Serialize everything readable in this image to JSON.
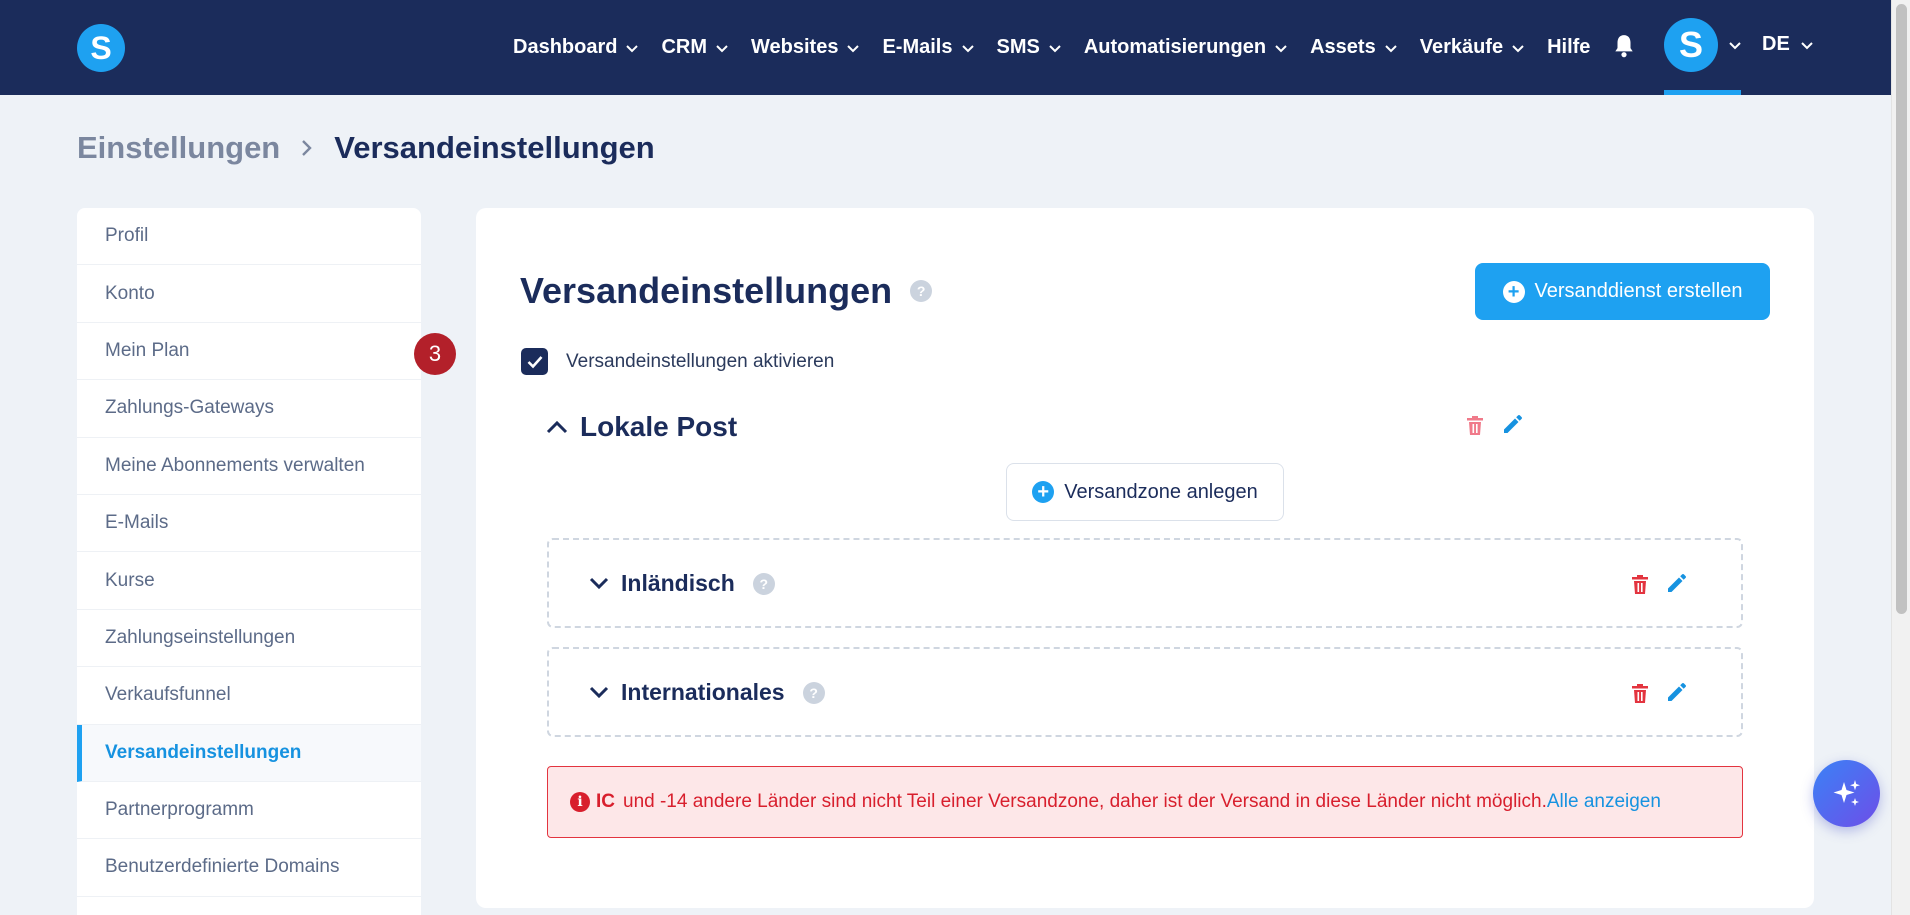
{
  "topbar": {
    "logo_letter": "S",
    "nav": [
      "Dashboard",
      "CRM",
      "Websites",
      "E-Mails",
      "SMS",
      "Automatisierungen",
      "Assets",
      "Verkäufe"
    ],
    "help": "Hilfe",
    "avatar_letter": "S",
    "language": "DE"
  },
  "breadcrumb": {
    "parent": "Einstellungen",
    "current": "Versandeinstellungen"
  },
  "sidebar": {
    "items": [
      "Profil",
      "Konto",
      "Mein Plan",
      "Zahlungs-Gateways",
      "Meine Abonnements verwalten",
      "E-Mails",
      "Kurse",
      "Zahlungseinstellungen",
      "Verkaufsfunnel",
      "Versandeinstellungen",
      "Partnerprogramm",
      "Benutzerdefinierte Domains"
    ],
    "active_index": 9
  },
  "main": {
    "title": "Versandeinstellungen",
    "create_button": "Versanddienst erstellen",
    "enable_checkbox": {
      "label": "Versandeinstellungen aktivieren",
      "checked": true
    },
    "step_badge": "3",
    "service": {
      "name": "Lokale Post",
      "add_zone_button": "Versandzone anlegen",
      "zones": [
        "Inländisch",
        "Internationales"
      ]
    },
    "alert": {
      "bold": "IC",
      "text": "und -14 andere Länder sind nicht Teil einer Versandzone, daher ist der Versand in diese Länder nicht möglich.",
      "link": "Alle anzeigen"
    }
  },
  "colors": {
    "topbar": "#1b2c5b",
    "accent": "#1ea1f1",
    "danger": "#e3343f",
    "highlight": "#b3202a"
  }
}
